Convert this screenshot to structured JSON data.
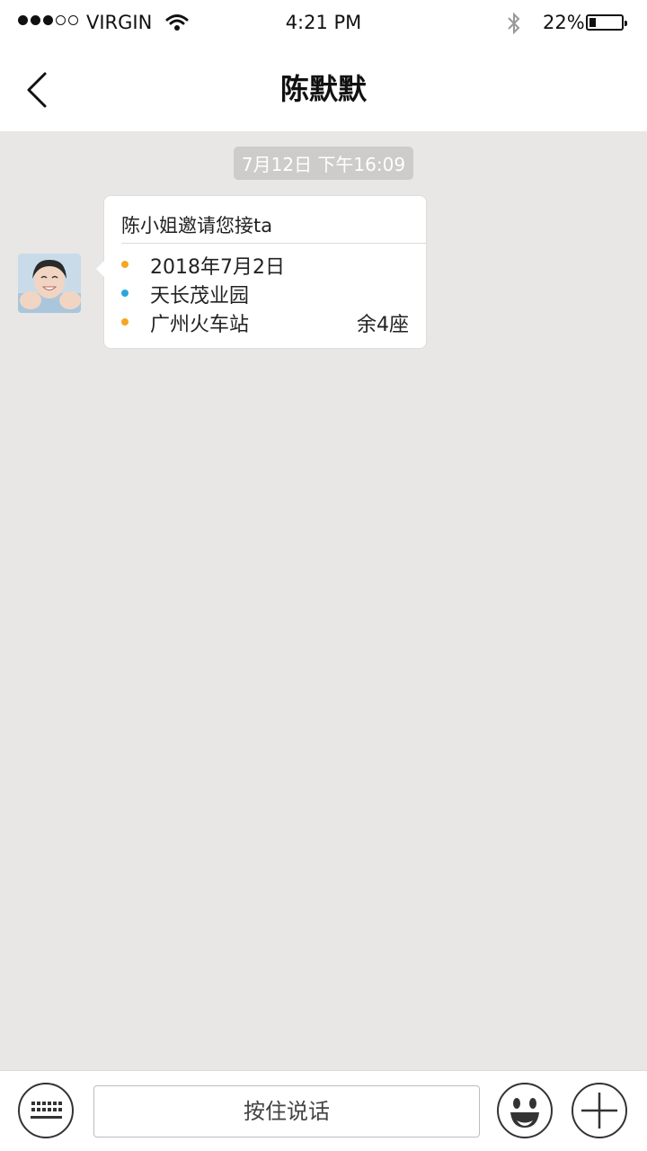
{
  "status_bar": {
    "carrier": "VIRGIN",
    "time": "4:21 PM",
    "battery_percent": "22%",
    "battery_level": 0.22,
    "signal_strength": 3,
    "icons": [
      "signal-dots-icon",
      "wifi-icon",
      "bluetooth-icon",
      "battery-icon"
    ]
  },
  "nav": {
    "title": "陈默默",
    "back_icon": "chevron-left-icon"
  },
  "chat": {
    "timestamp": "7月12日 下午16:09",
    "message": {
      "title": "陈小姐邀请您接ta",
      "date": "2018年7月2日",
      "origin": "天长茂业园",
      "destination": "广州火车站",
      "seats": "余4座",
      "bullet_colors": {
        "date": "#f5a623",
        "origin": "#2aa6df",
        "destination": "#f5a623"
      }
    }
  },
  "input_bar": {
    "keyboard_icon": "keyboard-icon",
    "hold_to_talk": "按住说话",
    "emoji_icon": "emoji-icon",
    "plus_icon": "plus-icon"
  },
  "colors": {
    "background": "#e8e7e5",
    "bubble": "#ffffff",
    "timestamp_pill": "#cdcccb"
  }
}
